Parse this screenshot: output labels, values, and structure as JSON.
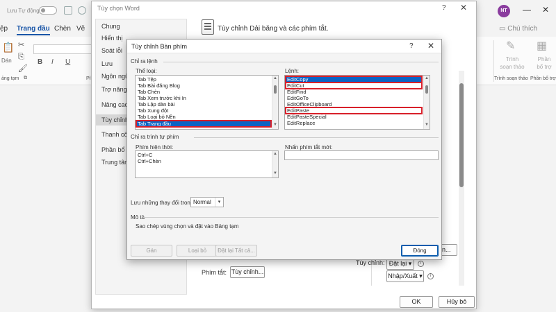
{
  "word": {
    "autosave_label": "Lưu Tự động",
    "avatar_initials": "NT",
    "tabs": [
      "ệp",
      "Trang đầu",
      "Chèn",
      "Vẽ"
    ],
    "chat_button": "Chú thích",
    "ribbon": {
      "paste_label": "Dán",
      "clipboard_label": "ảng tạm",
      "group_right_1": "Trình soạn thảo",
      "group_right_2": "Phần bổ trợ",
      "editor_btn_1": "Trình",
      "editor_btn_2": "soạn thảo",
      "addin_btn_1": "Phần",
      "addin_btn_2": "bổ trợ",
      "font_symbols": [
        "B",
        "I",
        "U"
      ],
      "trailing_letter": "Pł"
    }
  },
  "options_dialog": {
    "title": "Tùy chọn Word",
    "header": "Tùy chỉnh Dải băng và các phím tắt.",
    "nav": [
      "Chung",
      "Hiển thị",
      "Soát lỗi",
      "Lưu",
      "Ngôn ngữ",
      "Trợ năng",
      "Nâng cao",
      "Tùy chỉnh",
      "Thanh côn",
      "Phần bổ tr",
      "Trung tâm"
    ],
    "shortcut_label": "Phím tắt:",
    "customize_button": "Tùy chỉnh...",
    "tuy_chinh_label": "Tùy chỉnh:",
    "reset_button": "Đặt lại",
    "import_export_button": "Nhập/Xuất",
    "partial_button": "ện...",
    "ok_button": "OK",
    "cancel_button": "Hủy bỏ"
  },
  "keyboard_dialog": {
    "title": "Tùy chỉnh Bàn phím",
    "section_commands": "Chỉ ra lệnh",
    "categories_label": "Thể loại:",
    "commands_label": "Lệnh:",
    "categories": [
      "Tab Tệp",
      "Tab Bài đăng Blog",
      "Tab Chèn",
      "Tab Xem trước khi In",
      "Tab Lập dàn bài",
      "Tab Xung đột",
      "Tab Loại bỏ Nền",
      "Tab Trang đầu"
    ],
    "commands": [
      "EditCopy",
      "EditCut",
      "EditFind",
      "EditGoTo",
      "EditOfficeClipboard",
      "EditPaste",
      "EditPasteSpecial",
      "EditReplace"
    ],
    "section_keys": "Chỉ ra trình tự phím",
    "current_keys_label": "Phím hiện thời:",
    "current_keys": [
      "Ctrl+C",
      "Ctrl+Chèn"
    ],
    "new_key_label": "Nhấn phím tắt mới:",
    "new_key_value": "",
    "save_in_label": "Lưu những thay đổi trong:",
    "save_in_value": "Normal",
    "description_label": "Mô tả",
    "description_text": "Sao chép vùng chọn và đặt vào Bảng tạm",
    "assign_button": "Gán",
    "remove_button": "Loại bỏ",
    "reset_all_button": "Đặt lại Tất cả...",
    "close_button": "Đóng"
  }
}
